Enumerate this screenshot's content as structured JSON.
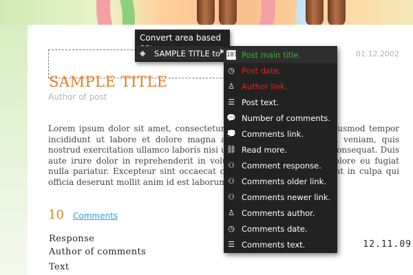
{
  "post": {
    "title": "SAMPLE TITLE",
    "date": "01.12.2002",
    "author": "Author of post",
    "text": "Lorem ipsum dolor sit amet, consectetur adipisicing elit, sed do eiusmod tempor incididunt ut labore et dolore magna aliqua. Ut enim ad minim veniam, quis nostrud exercitation ullamco laboris nisi ut aliquip ex ea commodo consequat. Duis aute irure dolor in reprehenderit in voluptate velit esse cillum dolore eu fugiat nulla pariatur. Excepteur sint occaecat cupidatat non proident, sunt in culpa qui officia deserunt mollit anim id est laborum."
  },
  "comments": {
    "count": "10",
    "link_label": "Comments",
    "response": "Response",
    "author": "Author of comments",
    "text": "Text",
    "date": "12.11.09"
  },
  "context_menu": {
    "heading": "Convert area based on:",
    "selected_item": "SAMPLE TITLE to",
    "arrow": "▶",
    "diamond": "◆"
  },
  "submenu": {
    "items": [
      {
        "icon": "date-box-icon",
        "glyph": "101",
        "label": "Post main title.",
        "color": "#2fba2f"
      },
      {
        "icon": "clock-icon",
        "glyph": "◷",
        "label": "Post date.",
        "color": "#ee1c1c"
      },
      {
        "icon": "person-icon",
        "glyph": "♙",
        "label": "Author link.",
        "color": "#ee1c1c"
      },
      {
        "icon": "text-lines-icon",
        "glyph": "☰",
        "label": "Post text.",
        "color": "#ffffff"
      },
      {
        "icon": "speech-bubble-icon",
        "glyph": "💬",
        "label": "Number of comments.",
        "color": "#ffffff"
      },
      {
        "icon": "speech-bubble-icon",
        "glyph": "💭",
        "label": "Comments link.",
        "color": "#ffffff"
      },
      {
        "icon": "chain-link-icon",
        "glyph": "⛓",
        "label": "Read more.",
        "color": "#ffffff"
      },
      {
        "icon": "people-icon",
        "glyph": "⚇",
        "label": "Comment response.",
        "color": "#ffffff"
      },
      {
        "icon": "people-icon",
        "glyph": "⚇",
        "label": "Comments older link.",
        "color": "#ffffff"
      },
      {
        "icon": "people-icon",
        "glyph": "⚇",
        "label": "Comments newer link.",
        "color": "#ffffff"
      },
      {
        "icon": "person-icon",
        "glyph": "♙",
        "label": "Comments author.",
        "color": "#ffffff"
      },
      {
        "icon": "clock-icon",
        "glyph": "◷",
        "label": "Comments date.",
        "color": "#ffffff"
      },
      {
        "icon": "text-lines-icon",
        "glyph": "☰",
        "label": "Comments text.",
        "color": "#ffffff"
      }
    ]
  },
  "colors": {
    "accent_orange": "#e27d23",
    "link_blue": "#2d9ed8",
    "menu_bg": "#222222",
    "highlight_green": "#2fba2f",
    "highlight_red": "#ee1c1c"
  }
}
